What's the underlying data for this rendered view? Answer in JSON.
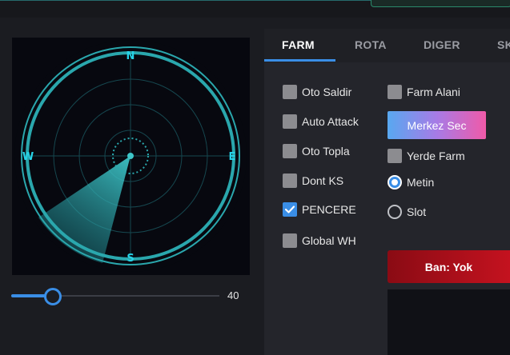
{
  "radar": {
    "north": "N",
    "south": "S",
    "east": "E",
    "west": "W",
    "colors": {
      "ring": "#2aa7ad",
      "grid": "#16474f",
      "sweep": "#3ec6c9",
      "label": "#27d3e8"
    }
  },
  "slider": {
    "value": "40",
    "fraction": 0.2
  },
  "tabs": [
    "FARM",
    "ROTA",
    "DIGER",
    "SK"
  ],
  "active_tab": "FARM",
  "left_options": [
    {
      "label": "Oto Saldir",
      "checked": false
    },
    {
      "label": "Auto Attack",
      "checked": false
    },
    {
      "label": "Oto Topla",
      "checked": false
    },
    {
      "label": "Dont KS",
      "checked": false
    },
    {
      "label": "PENCERE",
      "checked": true
    },
    {
      "label": "Global WH",
      "checked": false
    }
  ],
  "farm_alani": {
    "label": "Farm Alani",
    "checked": false
  },
  "merkez_button": "Merkez Sec",
  "yerde_farm": {
    "label": "Yerde Farm",
    "checked": false
  },
  "radios": [
    {
      "label": "Metin",
      "selected": true
    },
    {
      "label": "Slot",
      "selected": false
    }
  ],
  "ban_status": "Ban: Yok",
  "accent": "#3a8ee6"
}
